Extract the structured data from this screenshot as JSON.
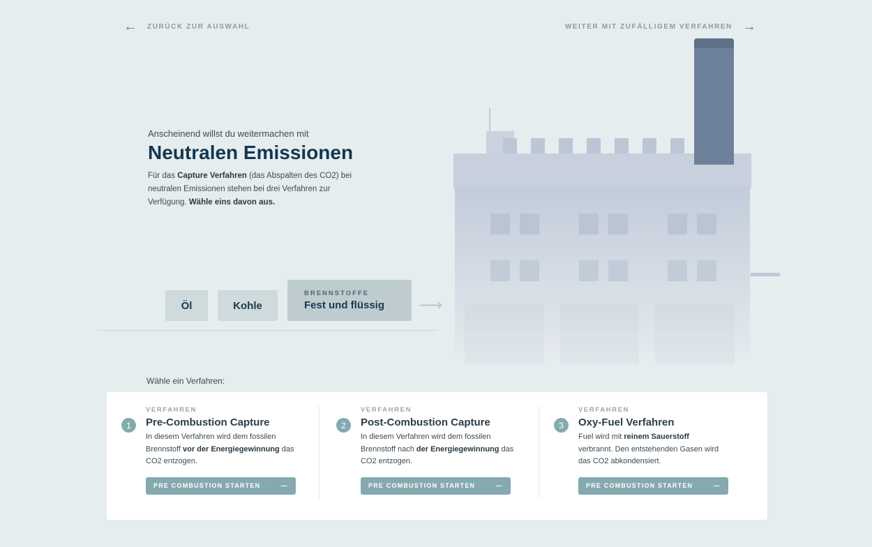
{
  "nav": {
    "back_label": "ZURÜCK ZUR AUSWAHL",
    "next_label": "WEITER MIT ZUFÄLLIGEM VERFAHREN"
  },
  "intro": {
    "pre": "Anscheinend willst du weitermachen mit",
    "title": "Neutralen Emissionen",
    "p1": "Für das ",
    "p1b": "Capture Verfahren",
    "p2": " (das Abspalten des CO2) bei neutralen Emissionen stehen bei drei Verfahren zur Verfügung. ",
    "p2b": "Wähle eins davon aus."
  },
  "fuels": {
    "oil": "Öl",
    "coal": "Kohle",
    "selected_kicker": "BRENNSTOFFE",
    "selected": "Fest und flüssig"
  },
  "choose_label": "Wähle ein Verfahren:",
  "procedures": [
    {
      "num": "1",
      "kicker": "VERFAHREN",
      "title": "Pre-Combustion Capture",
      "t1": "In diesem Verfahren wird dem fossilen Brennstoff ",
      "b": "vor der Energiegewinnung",
      "t2": " das CO2 entzogen.",
      "button": "PRE COMBUSTION STARTEN"
    },
    {
      "num": "2",
      "kicker": "VERFAHREN",
      "title": "Post-Combustion Capture",
      "t1": "In diesem Verfahren wird dem fossilen Brennstoff nach ",
      "b": "der Energiegewinnung",
      "t2": " das CO2 entzogen.",
      "button": "PRE COMBUSTION STARTEN"
    },
    {
      "num": "3",
      "kicker": "VERFAHREN",
      "title": "Oxy-Fuel Verfahren",
      "t1": "Fuel wird mit ",
      "b": "reinem Sauerstoff",
      "t2": " verbrannt. Den entstehenden Gasen wird das CO2 abkondensiert.",
      "button": "PRE COMBUSTION STARTEN"
    }
  ],
  "colors": {
    "accent": "#84aab0",
    "title": "#12384f",
    "chimney": "#6e819b"
  }
}
